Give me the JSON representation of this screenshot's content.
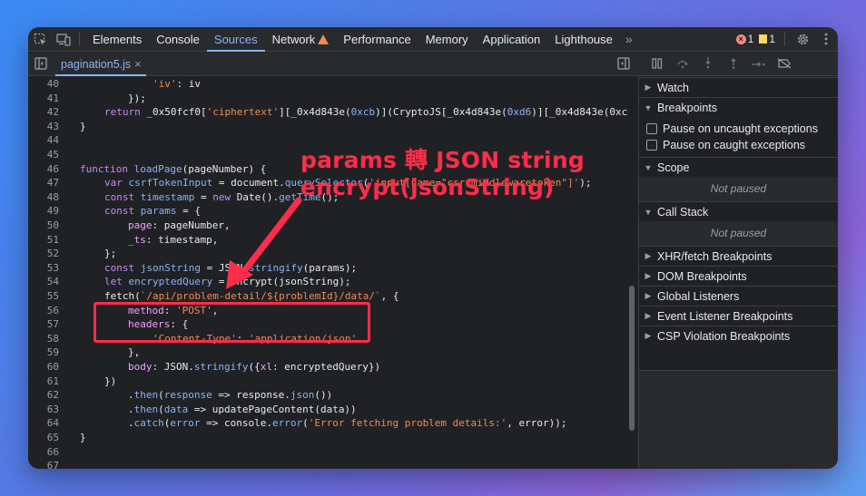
{
  "toolbar": {
    "tabs": [
      "Elements",
      "Console",
      "Sources",
      "Network",
      "Performance",
      "Memory",
      "Application",
      "Lighthouse"
    ],
    "active_tab": "Sources",
    "more": "»",
    "errors": "1",
    "warnings": "1"
  },
  "file_tab": {
    "name": "pagination5.js",
    "close": "×"
  },
  "code_lines": [
    {
      "n": "40"
    },
    {
      "n": "41"
    },
    {
      "n": "42"
    },
    {
      "n": "43"
    },
    {
      "n": "44"
    },
    {
      "n": "45"
    },
    {
      "n": "46"
    },
    {
      "n": "47"
    },
    {
      "n": "48"
    },
    {
      "n": "49"
    },
    {
      "n": "50"
    },
    {
      "n": "51"
    },
    {
      "n": "52"
    },
    {
      "n": "53"
    },
    {
      "n": "54"
    },
    {
      "n": "55"
    },
    {
      "n": "56"
    },
    {
      "n": "57"
    },
    {
      "n": "58"
    },
    {
      "n": "59"
    },
    {
      "n": "60"
    },
    {
      "n": "61"
    },
    {
      "n": "62"
    },
    {
      "n": "63"
    },
    {
      "n": "64"
    },
    {
      "n": "65"
    },
    {
      "n": "66"
    },
    {
      "n": "67"
    }
  ],
  "code": {
    "l40_a": "'iv'",
    "l40_b": ": iv",
    "l41": "});",
    "l42_a": "return",
    "l42_b": " _0x50fcf0[",
    "l42_c": "'ciphertext'",
    "l42_d": "][_0x4d843e(",
    "l42_e": "0xcb",
    "l42_f": ")](CryptoJS[_0x4d843e(",
    "l42_g": "0xd6",
    "l42_h": ")][_0x4d843e(0xc",
    "l43": "}",
    "l46_a": "function",
    "l46_b": "loadPage",
    "l46_c": "(pageNumber) {",
    "l47_a": "var",
    "l47_b": "csrfTokenInput",
    "l47_c": " = document.",
    "l47_d": "querySelector",
    "l47_e": "(",
    "l47_f": "'input[name=\"csrfmiddlewaretoken\"]'",
    "l47_g": ");",
    "l48_a": "const",
    "l48_b": "timestamp",
    "l48_c": " = ",
    "l48_d": "new",
    "l48_e": " Date().",
    "l48_f": "getTime",
    "l48_g": "();",
    "l49_a": "const",
    "l49_b": "params",
    "l49_c": " = {",
    "l50_a": "page",
    "l50_b": ": pageNumber,",
    "l51_a": "_ts",
    "l51_b": ": timestamp,",
    "l52": "};",
    "l53_a": "const",
    "l53_b": "jsonString",
    "l53_c": " = JSON.",
    "l53_d": "stringify",
    "l53_e": "(params);",
    "l54_a": "let",
    "l54_b": "encryptedQuery",
    "l54_c": " = encrypt(jsonString);",
    "l55_a": "fetch(",
    "l55_b": "`/api/problem-detail/${problemId}/data/`",
    "l55_c": ", {",
    "l56_a": "method",
    "l56_b": ": ",
    "l56_c": "'POST'",
    "l56_d": ",",
    "l57_a": "headers",
    "l57_b": ": {",
    "l58_a": "'Content-Type'",
    "l58_b": ": ",
    "l58_c": "'application/json'",
    "l59": "},",
    "l60_a": "body",
    "l60_b": ": JSON.",
    "l60_c": "stringify",
    "l60_d": "({",
    "l60_e": "xl",
    "l60_f": ": encryptedQuery})",
    "l61": "})",
    "l62_a": ".",
    "l62_b": "then",
    "l62_c": "(",
    "l62_d": "response",
    "l62_e": " => response.",
    "l62_f": "json",
    "l62_g": "())",
    "l63_a": ".",
    "l63_b": "then",
    "l63_c": "(",
    "l63_d": "data",
    "l63_e": " => updatePageContent(data))",
    "l64_a": ".",
    "l64_b": "catch",
    "l64_c": "(",
    "l64_d": "error",
    "l64_e": " => console.",
    "l64_f": "error",
    "l64_g": "(",
    "l64_h": "'Error fetching problem details:'",
    "l64_i": ", error));",
    "l65": "}"
  },
  "annotation": {
    "line1": "params 轉 JSON string",
    "line2": "encrypt(jsonString)",
    "color": "#ff2d4a"
  },
  "debugger": {
    "sections": {
      "watch": "Watch",
      "breakpoints": "Breakpoints",
      "uncaught": "Pause on uncaught exceptions",
      "caught": "Pause on caught exceptions",
      "scope": "Scope",
      "scope_status": "Not paused",
      "callstack": "Call Stack",
      "callstack_status": "Not paused",
      "xhr": "XHR/fetch Breakpoints",
      "dom": "DOM Breakpoints",
      "global": "Global Listeners",
      "event": "Event Listener Breakpoints",
      "csp": "CSP Violation Breakpoints"
    }
  },
  "colors": {
    "accent": "#8ab4f8",
    "background": "#202124",
    "annotation": "#ff2d4a"
  }
}
